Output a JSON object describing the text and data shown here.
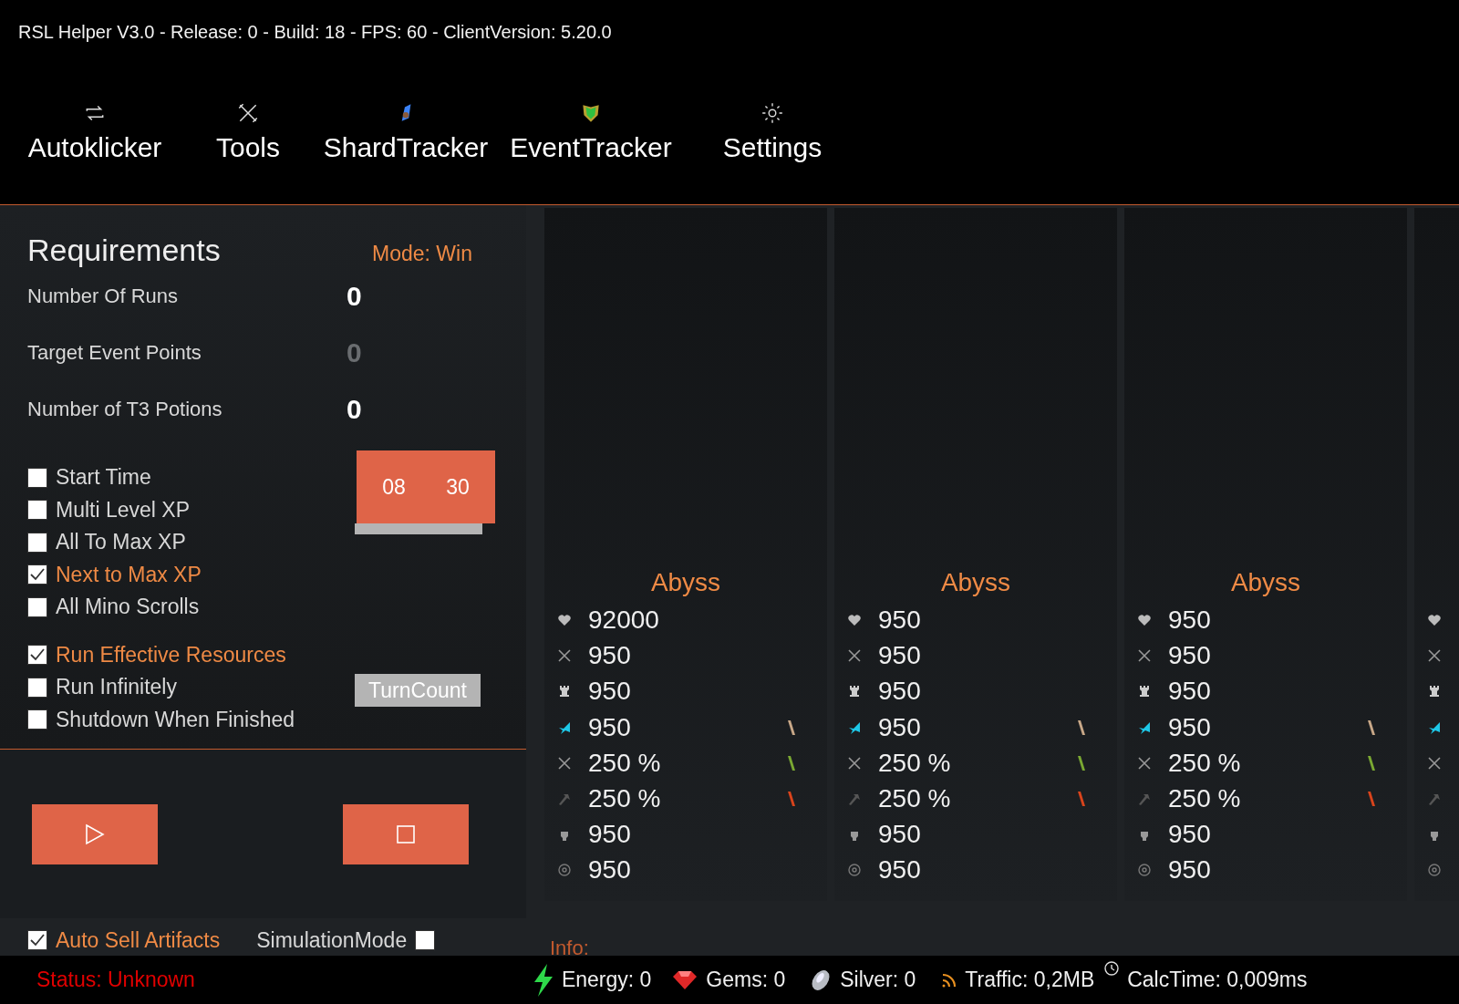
{
  "window": {
    "title": "RSL Helper V3.0 - Release: 0 - Build: 18 - FPS: 60 - ClientVersion: 5.20.0"
  },
  "nav": [
    {
      "label": "Autoklicker"
    },
    {
      "label": "Tools"
    },
    {
      "label": "ShardTracker"
    },
    {
      "label": "EventTracker"
    },
    {
      "label": "Settings"
    }
  ],
  "requirements": {
    "title": "Requirements",
    "mode": "Mode: Win",
    "fields": [
      {
        "label": "Number Of Runs",
        "value": "0",
        "disabled": false
      },
      {
        "label": "Target Event Points",
        "value": "0",
        "disabled": true
      },
      {
        "label": "Number of T3 Potions",
        "value": "0",
        "disabled": false
      }
    ],
    "option_groups": [
      [
        {
          "label": "Start Time",
          "checked": false
        },
        {
          "label": "Multi Level XP",
          "checked": false
        },
        {
          "label": "All To Max XP",
          "checked": false
        },
        {
          "label": "Next to Max XP",
          "checked": true
        },
        {
          "label": "All Mino Scrolls",
          "checked": false
        }
      ],
      [
        {
          "label": "Run Effective Resources",
          "checked": true
        },
        {
          "label": "Run Infinitely",
          "checked": false
        },
        {
          "label": "Shutdown When Finished",
          "checked": false
        }
      ]
    ],
    "start_time": {
      "hour": "08",
      "minute": "30"
    },
    "turn_count_button": "TurnCount"
  },
  "controls": [
    {
      "kind": "play"
    },
    {
      "kind": "stop"
    }
  ],
  "bottom_options": [
    {
      "label": "Auto Sell Artifacts",
      "checked": true
    },
    {
      "label": "SimulationMode",
      "checked": false
    }
  ],
  "cards": [
    {
      "title": "Abyss",
      "stats": [
        "92000",
        "950",
        "950",
        "950",
        "250 %",
        "250 %",
        "950",
        "950"
      ]
    },
    {
      "title": "Abyss",
      "stats": [
        "950",
        "950",
        "950",
        "950",
        "250 %",
        "250 %",
        "950",
        "950"
      ]
    },
    {
      "title": "Abyss",
      "stats": [
        "950",
        "950",
        "950",
        "950",
        "250 %",
        "250 %",
        "950",
        "950"
      ]
    }
  ],
  "info": "Info:",
  "status_bar": [
    {
      "kind": "status",
      "text": "Status: Unknown"
    },
    {
      "kind": "energy",
      "text": "Energy: 0"
    },
    {
      "kind": "gems",
      "text": "Gems: 0"
    },
    {
      "kind": "silver",
      "text": "Silver: 0"
    },
    {
      "kind": "traffic",
      "text": "Traffic: 0,2MB"
    },
    {
      "kind": "calc",
      "text": "CalcTime: 0,009ms"
    }
  ]
}
